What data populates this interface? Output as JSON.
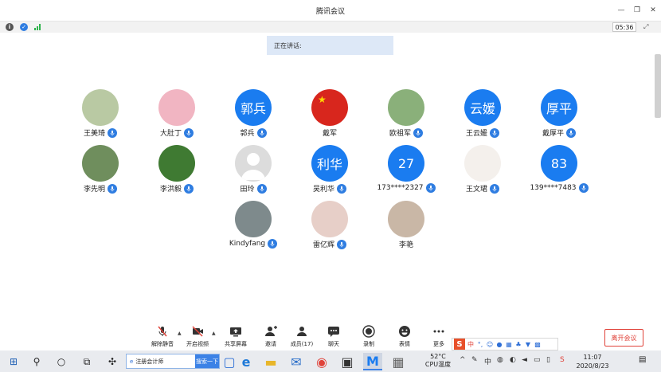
{
  "window": {
    "title": "腾讯会议"
  },
  "status": {
    "timer": "05:36"
  },
  "speaking": {
    "label": "正在讲话:"
  },
  "participants": [
    {
      "name": "王美琦",
      "avatar_text": "",
      "avatar_color": "#b9c9a3",
      "mic": "active"
    },
    {
      "name": "大肚丁",
      "avatar_text": "",
      "avatar_color": "#f1b5c2",
      "mic": "active"
    },
    {
      "name": "郭兵",
      "avatar_text": "郭兵",
      "avatar_color": "#1a7cf0",
      "mic": "active"
    },
    {
      "name": "戴军",
      "avatar_text": "",
      "avatar_color": "#d8261d",
      "mic": "none"
    },
    {
      "name": "欧祖军",
      "avatar_text": "",
      "avatar_color": "#8ab07a",
      "mic": "active"
    },
    {
      "name": "王云媛",
      "avatar_text": "云媛",
      "avatar_color": "#1a7cf0",
      "mic": "active"
    },
    {
      "name": "戴厚平",
      "avatar_text": "厚平",
      "avatar_color": "#1a7cf0",
      "mic": "active"
    },
    {
      "name": "李先明",
      "avatar_text": "",
      "avatar_color": "#6f8e5d",
      "mic": "active"
    },
    {
      "name": "李洪毅",
      "avatar_text": "",
      "avatar_color": "#3f7a32",
      "mic": "active"
    },
    {
      "name": "田玲",
      "avatar_text": "",
      "avatar_color": "#dcdcdc",
      "mic": "active"
    },
    {
      "name": "吴利华",
      "avatar_text": "利华",
      "avatar_color": "#1a7cf0",
      "mic": "active"
    },
    {
      "name": "173****2327",
      "avatar_text": "27",
      "avatar_color": "#1a7cf0",
      "mic": "active"
    },
    {
      "name": "王文珺",
      "avatar_text": "",
      "avatar_color": "#f4f0ec",
      "mic": "active"
    },
    {
      "name": "139****7483",
      "avatar_text": "83",
      "avatar_color": "#1a7cf0",
      "mic": "active"
    },
    {
      "name": "Kindyfang",
      "avatar_text": "",
      "avatar_color": "#7e8a8c",
      "mic": "active"
    },
    {
      "name": "雷亿辉",
      "avatar_text": "",
      "avatar_color": "#e7cfc8",
      "mic": "active"
    },
    {
      "name": "李艳",
      "avatar_text": "",
      "avatar_color": "#c9b7a6",
      "mic": "none"
    }
  ],
  "toolbar": {
    "unmute": "解除静音",
    "start_video": "开启视频",
    "share_screen": "共享屏幕",
    "invite": "邀请",
    "members": "成员(17)",
    "chat": "聊天",
    "record": "录制",
    "reactions": "表情",
    "more": "更多",
    "leave": "离开会议"
  },
  "ime": {
    "mode": "中"
  },
  "taskbar": {
    "search_text": "注册会计师",
    "search_button": "搜索一下",
    "temp_value": "52°C",
    "temp_label": "CPU温度",
    "time": "11:07",
    "date": "2020/8/23"
  }
}
